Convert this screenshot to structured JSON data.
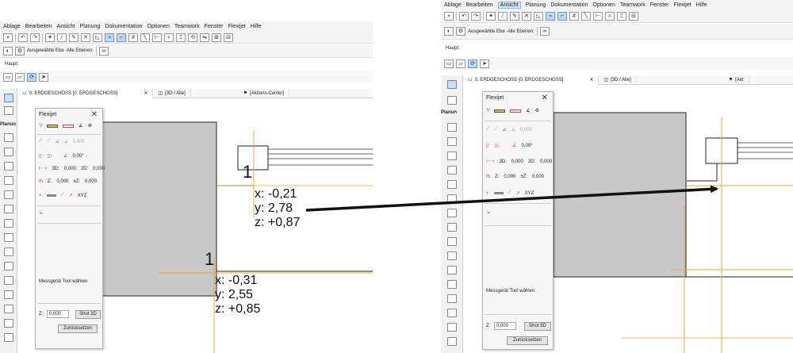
{
  "menu": {
    "items": [
      "Ablage",
      "Bearbeiten",
      "Ansicht",
      "Planung",
      "Dokumentation",
      "Optionen",
      "Teamwork",
      "Fenster",
      "Flexijet",
      "Hilfe"
    ],
    "active": "Ansicht"
  },
  "toolbar": {
    "selected_layer_label": "Ausgewählte Ebe",
    "all_layers_label": "Alle Ebenen:",
    "haupt_label": "Haupt:"
  },
  "tabs": {
    "floor": "0. ERDGESCHOSS [0. ERDGESCHOSS]",
    "view3d": "[3D / Alle]",
    "actions": "[Aktions-Center]",
    "actions_short": "[Akt"
  },
  "toolbox": {
    "section_label": "Planun"
  },
  "flexijet": {
    "title": "Flexijet",
    "close": "✕",
    "val_angle": "0,00°",
    "val_grey": "0,000",
    "label_3d": "3D:",
    "val_3d": "0,000",
    "label_2d": "2D:",
    "val_2d": "0,000",
    "label_z": "Z:",
    "val_z": "0,000",
    "label_dz": "±Z:",
    "val_dz": "0,000",
    "xyz": "XYZ",
    "status": "Messgerät Tool wählen",
    "z_label": "Z:",
    "z_value": "0,000",
    "shot_button": "Shot 3D",
    "reset_button": "Zurücksetzen"
  },
  "annotations": {
    "marker1": "1",
    "marker2": "1",
    "point1": {
      "x": "x: -0,21",
      "y": "y: 2,78",
      "z": "z: +0,87"
    },
    "point2": {
      "x": "x: -0,31",
      "y": "y: 2,55",
      "z": "z: +0,85"
    }
  },
  "colors": {
    "wall_grey": "#c8c8c8",
    "guide_orange": "#f0a830",
    "selection_blue": "#bcd8f2"
  }
}
